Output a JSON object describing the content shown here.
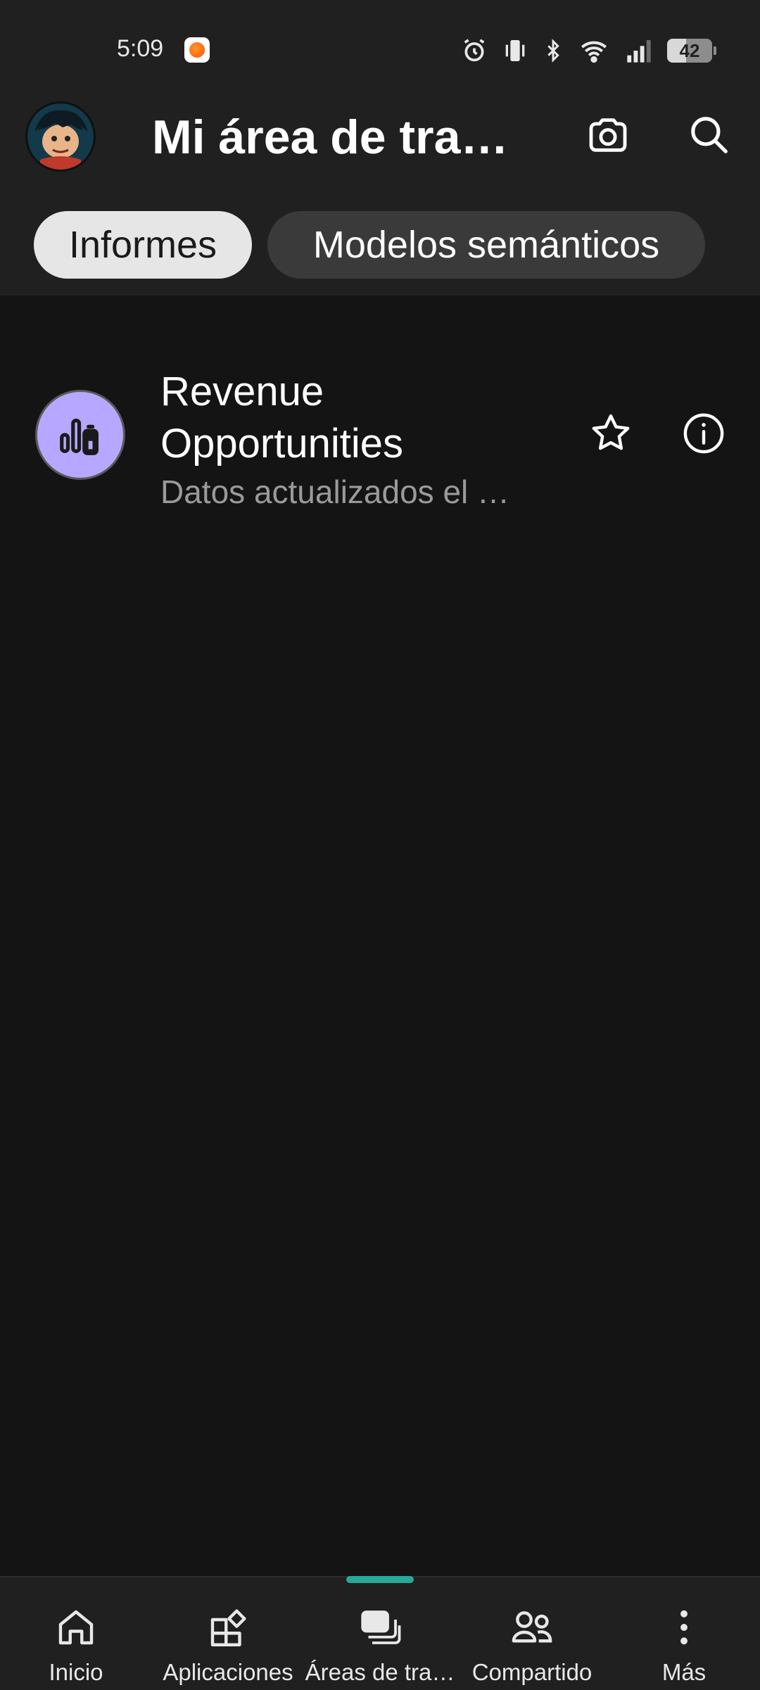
{
  "status_bar": {
    "time": "5:09",
    "battery": "42",
    "icons": [
      "app-notification-icon",
      "alarm-icon",
      "vibrate-icon",
      "bluetooth-icon",
      "wifi-icon",
      "signal-icon",
      "battery-icon"
    ]
  },
  "header": {
    "title": "Mi área de tra…",
    "actions": [
      "camera-icon",
      "search-icon"
    ]
  },
  "tabs": [
    {
      "label": "Informes",
      "selected": true
    },
    {
      "label": "Modelos semánticos",
      "selected": false
    }
  ],
  "reports": [
    {
      "title": "Revenue Opportunities",
      "subtitle": "Datos actualizados el …",
      "icon": "report-icon",
      "icon_color": "#b7a7ff"
    }
  ],
  "bottom_nav": [
    {
      "label": "Inicio",
      "icon": "home-icon",
      "active": false
    },
    {
      "label": "Aplicaciones",
      "icon": "apps-icon",
      "active": false
    },
    {
      "label": "Áreas de tra…",
      "icon": "workspaces-icon",
      "active": true
    },
    {
      "label": "Compartido",
      "icon": "shared-icon",
      "active": false
    },
    {
      "label": "Más",
      "icon": "more-icon",
      "active": false
    }
  ],
  "colors": {
    "accent": "#2aa89a",
    "background": "#141414",
    "surface": "#202020"
  }
}
